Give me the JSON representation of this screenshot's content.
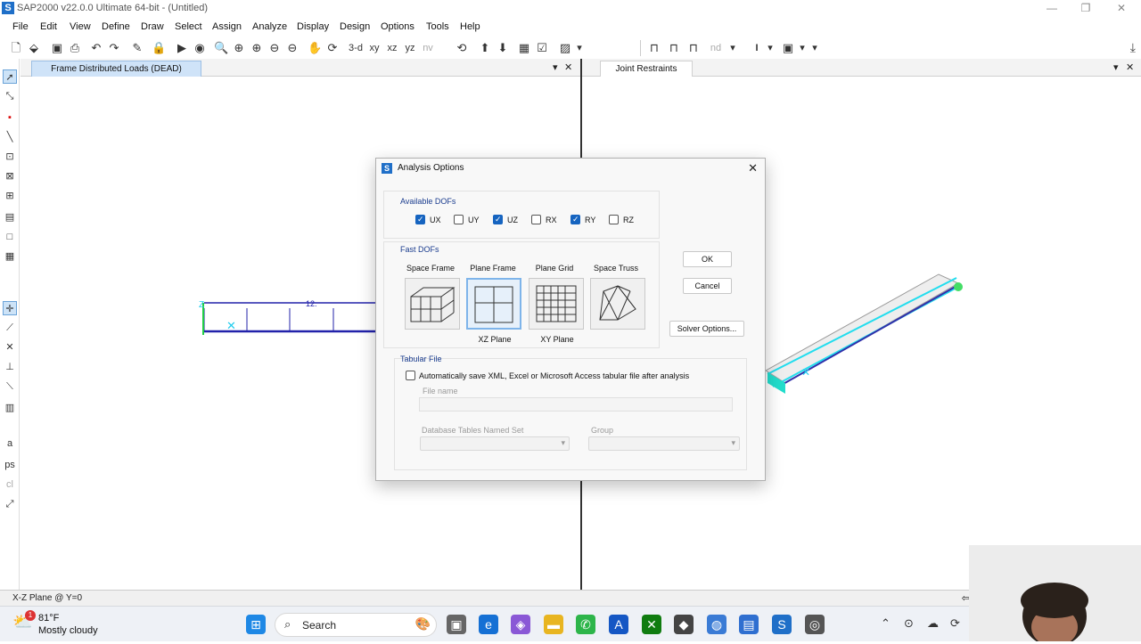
{
  "app": {
    "title": "SAP2000 v22.0.0 Ultimate 64-bit - (Untitled)",
    "logo": "S"
  },
  "window_controls": {
    "minimize": "—",
    "restore": "❐",
    "close": "✕"
  },
  "menu": [
    "File",
    "Edit",
    "View",
    "Define",
    "Draw",
    "Select",
    "Assign",
    "Analyze",
    "Display",
    "Design",
    "Options",
    "Tools",
    "Help"
  ],
  "toolbar": {
    "view_3d": "3-d",
    "view_xy": "xy",
    "view_xz": "xz",
    "view_yz": "yz",
    "view_nv": "nv",
    "nd": "nd",
    "text_icon": "I"
  },
  "left_pane": {
    "tab": "Frame Distributed Loads (DEAD)",
    "beam_label": "12.",
    "axis_z": "Z"
  },
  "right_pane": {
    "tab": "Joint Restraints"
  },
  "dialog": {
    "title": "Analysis Options",
    "available_dofs": {
      "label": "Available DOFs",
      "items": [
        {
          "label": "UX",
          "checked": true
        },
        {
          "label": "UY",
          "checked": false
        },
        {
          "label": "UZ",
          "checked": true
        },
        {
          "label": "RX",
          "checked": false
        },
        {
          "label": "RY",
          "checked": true
        },
        {
          "label": "RZ",
          "checked": false
        }
      ]
    },
    "fast_dofs": {
      "label": "Fast DOFs",
      "options": [
        {
          "label": "Space Frame",
          "plane": ""
        },
        {
          "label": "Plane Frame",
          "plane": "XZ Plane",
          "selected": true
        },
        {
          "label": "Plane Grid",
          "plane": "XY Plane"
        },
        {
          "label": "Space Truss",
          "plane": ""
        }
      ]
    },
    "buttons": {
      "ok": "OK",
      "cancel": "Cancel",
      "solver": "Solver Options..."
    },
    "tabular_file": {
      "label": "Tabular File",
      "checkbox_label": "Automatically save XML, Excel or Microsoft Access tabular file after analysis",
      "file_name_label": "File name",
      "db_tables_label": "Database Tables Named Set",
      "group_label": "Group"
    }
  },
  "status": {
    "text": "X-Z Plane @ Y=0"
  },
  "taskbar": {
    "weather": {
      "temp": "81°F",
      "desc": "Mostly cloudy",
      "badge": "1"
    },
    "search": "Search"
  }
}
